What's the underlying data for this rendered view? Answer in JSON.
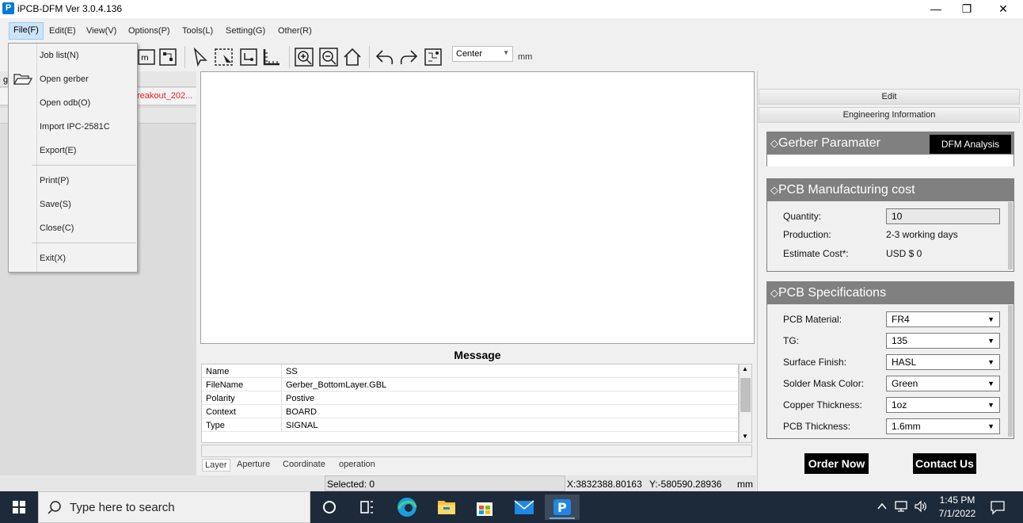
{
  "window": {
    "title": "iPCB-DFM Ver 3.0.4.136",
    "logo": "P",
    "minimize": "—",
    "maximize": "❐",
    "close": "✕"
  },
  "menubar": [
    "File(F)",
    "Edit(E)",
    "View(V)",
    "Options(P)",
    "Tools(L)",
    "Setting(G)",
    "Other(R)"
  ],
  "toolbar": {
    "align_value": "Center",
    "unit": "mm"
  },
  "file_menu": {
    "items": [
      "Job list(N)",
      "Open gerber",
      "Open odb(O)",
      "Import IPC-2581C",
      "Export(E)",
      "Print(P)",
      "Save(S)",
      "Close(C)",
      "Exit(X)"
    ]
  },
  "left_panel": {
    "row1_text": "g",
    "red_text": "reakout_202..."
  },
  "message": {
    "title": "Message",
    "rows": [
      {
        "key": "Name",
        "value": "SS"
      },
      {
        "key": "FileName",
        "value": "Gerber_BottomLayer.GBL"
      },
      {
        "key": "Polarity",
        "value": "Postive"
      },
      {
        "key": "Context",
        "value": "BOARD"
      },
      {
        "key": "Type",
        "value": "SIGNAL"
      }
    ],
    "tabs": [
      "Layer",
      "Aperture",
      "Coordinate",
      "operation"
    ]
  },
  "status": {
    "selected": "Selected: 0",
    "x": "X:3832388.80163",
    "y": "Y:-580590.28936",
    "unit": "mm"
  },
  "right_panel": {
    "edit_header": "Edit",
    "eng_header": "Engineering Information",
    "gerber": {
      "title": "Gerber Paramater",
      "dfm_button": "DFM Analysis"
    },
    "cost": {
      "title": "PCB Manufacturing cost",
      "quantity_label": "Quantity:",
      "quantity_value": "10",
      "production_label": "Production:",
      "production_value": "2-3 working days",
      "estimate_label": "Estimate Cost*:",
      "estimate_value": "USD $ 0"
    },
    "specs": {
      "title": "PCB Specifications",
      "items": [
        {
          "label": "PCB Material:",
          "value": "FR4"
        },
        {
          "label": "TG:",
          "value": "135"
        },
        {
          "label": "Surface Finish:",
          "value": "HASL"
        },
        {
          "label": "Solder Mask Color:",
          "value": "Green"
        },
        {
          "label": "Copper Thickness:",
          "value": "1oz"
        },
        {
          "label": "PCB Thickness:",
          "value": "1.6mm"
        }
      ]
    },
    "order_button": "Order Now",
    "contact_button": "Contact Us"
  },
  "taskbar": {
    "search_placeholder": "Type here to search",
    "time": "1:45 PM",
    "date": "7/1/2022"
  }
}
